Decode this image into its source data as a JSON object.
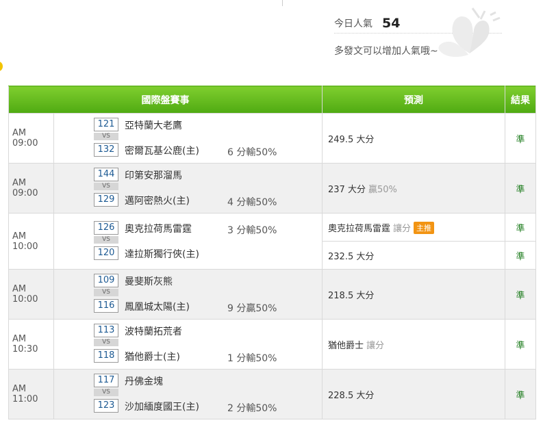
{
  "popularity": {
    "label": "今日人氣",
    "count": "54",
    "hint": "多發文可以增加人氣哦~"
  },
  "table": {
    "headers": {
      "games": "國際盤賽事",
      "prediction": "預測",
      "result": "結果"
    },
    "vs_label": "VS",
    "rows": [
      {
        "time": "AM 09:00",
        "home_num": "121",
        "home_team": "亞特蘭大老鷹",
        "home_odds": "",
        "away_num": "132",
        "away_team": "密爾瓦基公鹿(主)",
        "away_odds": "6 分輸50%",
        "predictions": [
          {
            "main": "249.5 大分",
            "sub": "",
            "badge": "",
            "result": "準"
          }
        ]
      },
      {
        "time": "AM 09:00",
        "home_num": "144",
        "home_team": "印第安那溜馬",
        "home_odds": "",
        "away_num": "129",
        "away_team": "邁阿密熱火(主)",
        "away_odds": "4 分輸50%",
        "predictions": [
          {
            "main": "237 大分",
            "sub": "贏50%",
            "badge": "",
            "result": "準"
          }
        ]
      },
      {
        "time": "AM 10:00",
        "home_num": "126",
        "home_team": "奧克拉荷馬雷霆",
        "home_odds": "3 分輸50%",
        "away_num": "120",
        "away_team": "達拉斯獨行俠(主)",
        "away_odds": "",
        "predictions": [
          {
            "main": "奧克拉荷馬雷霆",
            "sub": "讓分",
            "badge": "主推",
            "result": "準"
          },
          {
            "main": "232.5 大分",
            "sub": "",
            "badge": "",
            "result": "準"
          }
        ]
      },
      {
        "time": "AM 10:00",
        "home_num": "109",
        "home_team": "曼斐斯灰熊",
        "home_odds": "",
        "away_num": "116",
        "away_team": "鳳凰城太陽(主)",
        "away_odds": "9 分贏50%",
        "predictions": [
          {
            "main": "218.5 大分",
            "sub": "",
            "badge": "",
            "result": "準"
          }
        ]
      },
      {
        "time": "AM 10:30",
        "home_num": "113",
        "home_team": "波特蘭拓荒者",
        "home_odds": "",
        "away_num": "118",
        "away_team": "猶他爵士(主)",
        "away_odds": "1 分輸50%",
        "predictions": [
          {
            "main": "猶他爵士",
            "sub": "讓分",
            "badge": "",
            "result": "準"
          }
        ]
      },
      {
        "time": "AM 11:00",
        "home_num": "117",
        "home_team": "丹佛金塊",
        "home_odds": "",
        "away_num": "123",
        "away_team": "沙加緬度國王(主)",
        "away_odds": "2 分輸50%",
        "predictions": [
          {
            "main": "228.5 大分",
            "sub": "",
            "badge": "",
            "result": "準"
          }
        ]
      }
    ]
  },
  "colors": {
    "header_green": "#5cb81a",
    "result_green": "#1a7a1a",
    "badge_orange": "#f29413",
    "team_number_blue": "#1d5a93"
  },
  "icons": {
    "decoration": "butterfly-watermark-icon"
  }
}
